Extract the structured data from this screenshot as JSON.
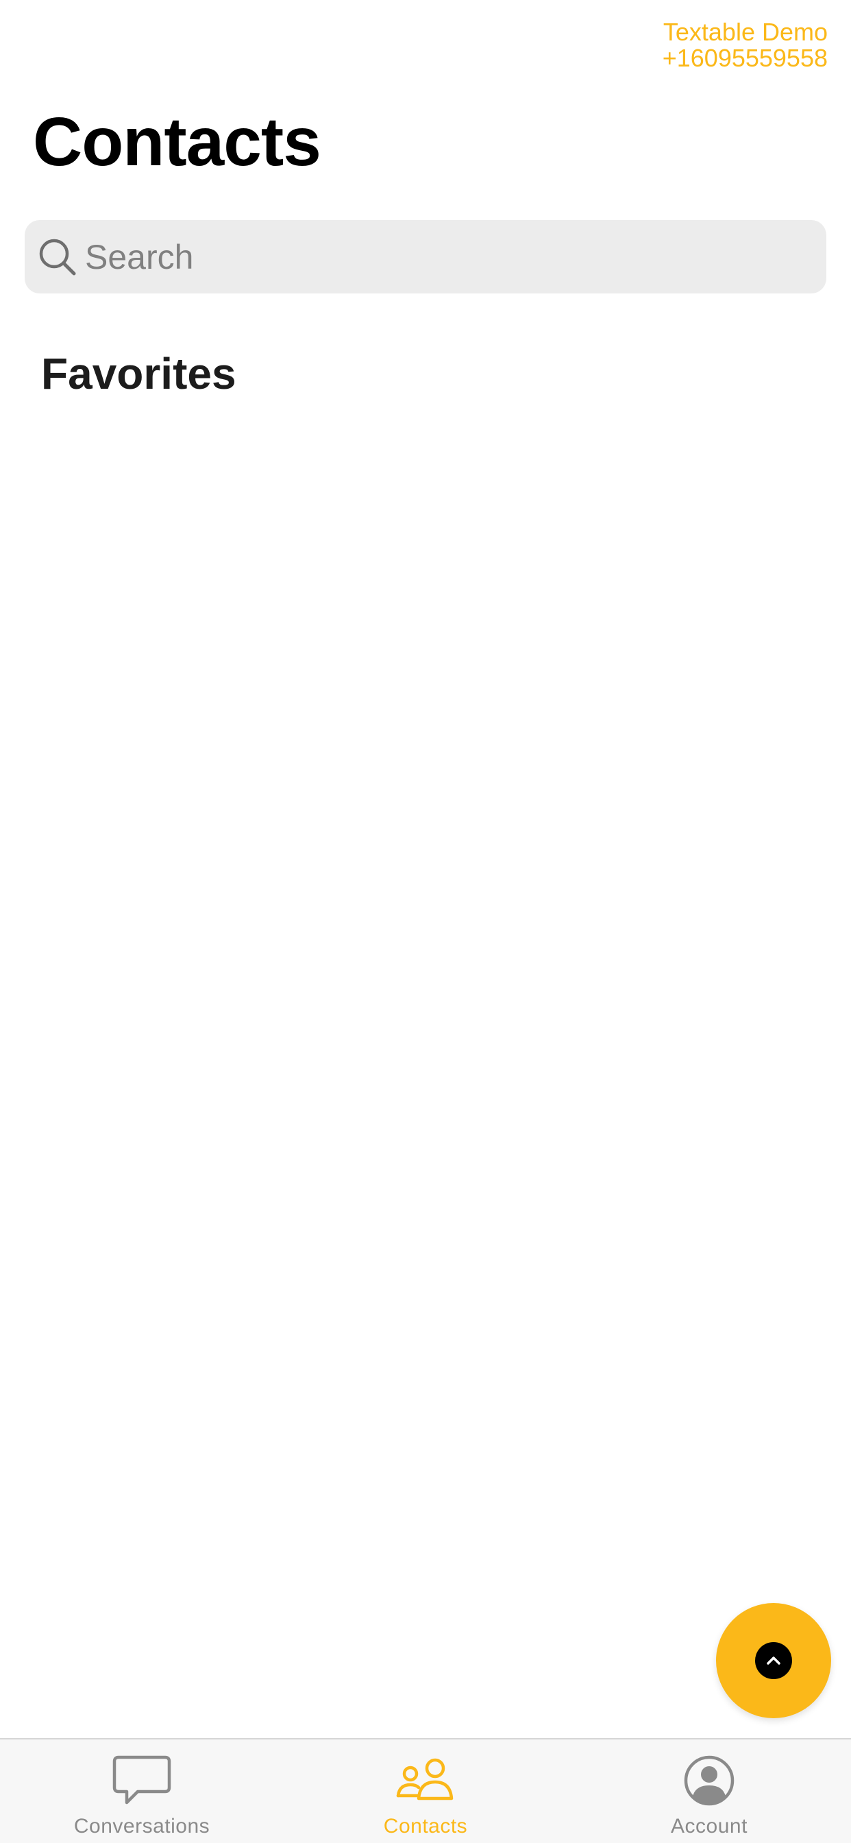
{
  "header": {
    "account_name": "Textable Demo",
    "account_phone": "+16095559558",
    "title": "Contacts"
  },
  "search": {
    "placeholder": "Search",
    "value": ""
  },
  "sections": {
    "favorites_title": "Favorites"
  },
  "fab": {
    "icon": "chevron-up-icon"
  },
  "tabbar": {
    "active_tab": "Contacts",
    "items": [
      {
        "label": "Conversations",
        "icon": "chat-bubble-icon"
      },
      {
        "label": "Contacts",
        "icon": "people-icon"
      },
      {
        "label": "Account",
        "icon": "account-circle-icon"
      }
    ]
  },
  "colors": {
    "accent": "#fbb819",
    "inactive": "#8a8a8a",
    "search_bg": "#ececec",
    "tabbar_bg": "#f7f7f7"
  }
}
